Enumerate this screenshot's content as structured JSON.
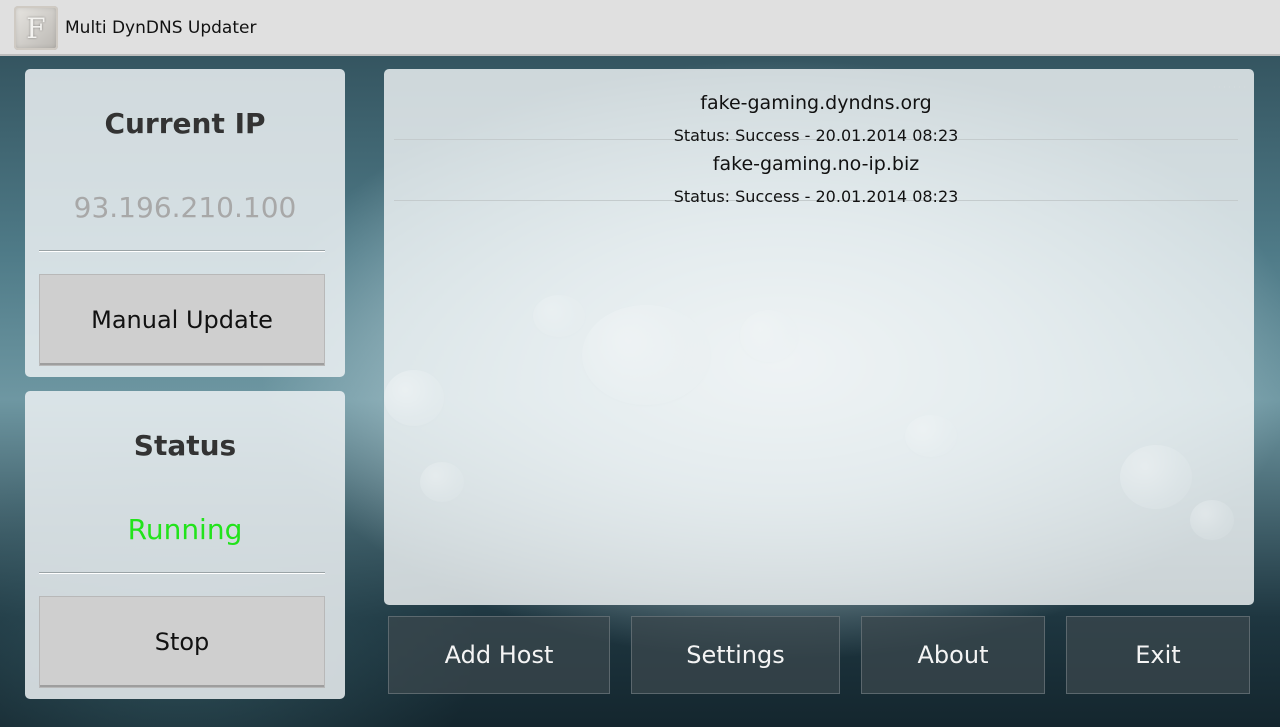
{
  "app": {
    "title": "Multi DynDNS Updater",
    "icon_letter": "F"
  },
  "ip_panel": {
    "title": "Current IP",
    "value": "93.196.210.100",
    "button_label": "Manual Update"
  },
  "status_panel": {
    "title": "Status",
    "value": "Running",
    "value_color": "#22e31b",
    "button_label": "Stop"
  },
  "hosts": [
    {
      "name": "fake-gaming.dyndns.org",
      "status": "Status: Success - 20.01.2014 08:23"
    },
    {
      "name": "fake-gaming.no-ip.biz",
      "status": "Status: Success - 20.01.2014 08:23"
    }
  ],
  "actions": {
    "add_host": "Add Host",
    "settings": "Settings",
    "about": "About",
    "exit": "Exit"
  }
}
